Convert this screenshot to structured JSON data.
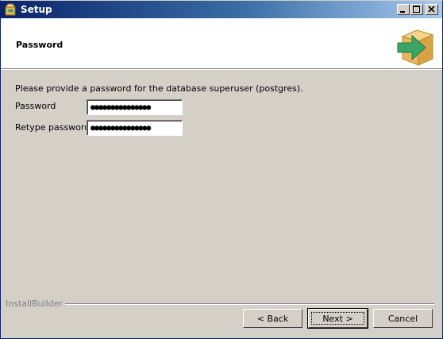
{
  "window": {
    "title": "Setup"
  },
  "header": {
    "title": "Password"
  },
  "form": {
    "prompt": "Please provide a password for the database superuser (postgres).",
    "password_label": "Password",
    "password_value": "●●●●●●●●●●●●●●●",
    "retype_label": "Retype password",
    "retype_value": "●●●●●●●●●●●●●●●"
  },
  "footer": {
    "brand": "InstallBuilder",
    "back_label": "< Back",
    "next_label": "Next >",
    "cancel_label": "Cancel"
  },
  "colors": {
    "titlebar_start": "#0a246a",
    "titlebar_end": "#a6caf0",
    "window_bg": "#d4d0c8",
    "logo_box": "#e8b55a",
    "logo_arrow": "#3aa564"
  }
}
